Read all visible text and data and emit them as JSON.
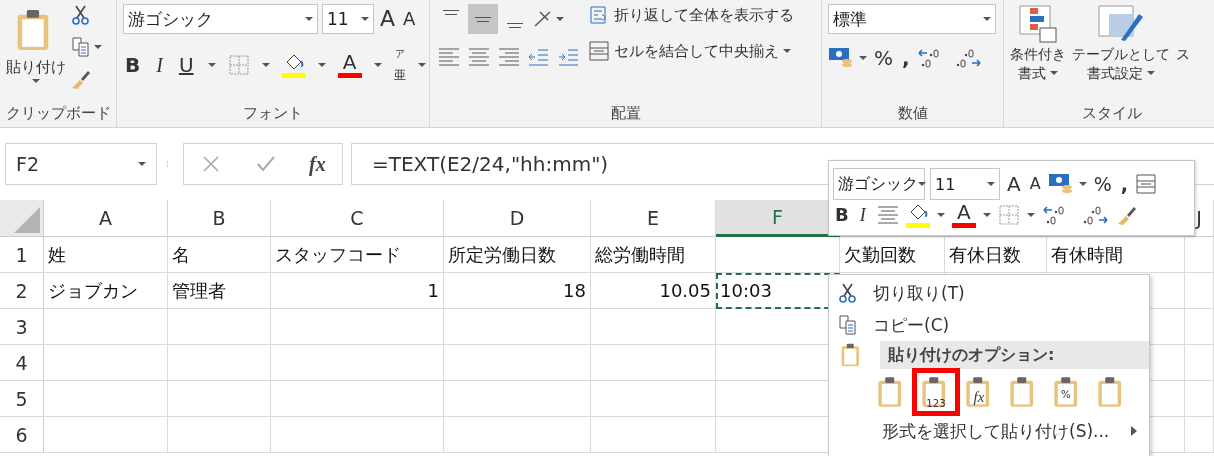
{
  "ribbon": {
    "clipboard": {
      "label": "クリップボード",
      "paste_label": "貼り付け"
    },
    "font": {
      "label": "フォント",
      "font_name": "游ゴシック",
      "font_size": "11",
      "grow": "A",
      "shrink": "A",
      "bold": "B",
      "italic": "I",
      "underline": "U",
      "font_color": "A",
      "phonetic_top": "ア",
      "phonetic_bottom": "亜"
    },
    "alignment": {
      "label": "配置",
      "vertical": [
        {
          "selected": false
        },
        {
          "selected": true
        },
        {
          "selected": false
        }
      ],
      "wrap_label": "折り返して全体を表示する",
      "merge_label": "セルを結合して中央揃え"
    },
    "number": {
      "label": "数値",
      "format": "標準",
      "percent": "%",
      "comma": ","
    },
    "styles": {
      "label": "スタイル",
      "buttons": [
        {
          "line1": "条件付き",
          "line2": "書式"
        },
        {
          "line1": "テーブルとして",
          "line2": "書式設定"
        },
        {
          "line1": "ス"
        }
      ]
    }
  },
  "formula_bar": {
    "name_box": "F2",
    "function_label": "fx",
    "formula": "=TEXT(E2/24,\"hh:mm\")"
  },
  "grid": {
    "columns": [
      {
        "label": "A",
        "selected": false
      },
      {
        "label": "B",
        "selected": false
      },
      {
        "label": "C",
        "selected": false
      },
      {
        "label": "D",
        "selected": false
      },
      {
        "label": "E",
        "selected": false
      },
      {
        "label": "F",
        "selected": true
      },
      {},
      {},
      {},
      {
        "label": "J",
        "selected": false
      }
    ],
    "rows": [
      {
        "number": "1",
        "cells": [
          {
            "text": "姓",
            "kind": "text",
            "selected": false
          },
          {
            "text": "名",
            "kind": "text",
            "selected": false
          },
          {
            "text": "スタッフコード",
            "kind": "text",
            "selected": false
          },
          {
            "text": "所定労働日数",
            "kind": "text",
            "selected": false
          },
          {
            "text": "総労働時間",
            "kind": "text",
            "selected": false
          },
          null,
          {
            "text": "欠勤回数",
            "kind": "text",
            "selected": false
          },
          {
            "text": "有休日数",
            "kind": "text",
            "selected": false
          },
          {
            "text": "有休時間",
            "kind": "text",
            "selected": false
          }
        ]
      },
      {
        "number": "2",
        "cells": [
          {
            "text": "ジョブカン",
            "kind": "text",
            "selected": false
          },
          {
            "text": "管理者",
            "kind": "text",
            "selected": false
          },
          {
            "text": "1",
            "kind": "number",
            "selected": false
          },
          {
            "text": "18",
            "kind": "number",
            "selected": false
          },
          {
            "text": "10.05",
            "kind": "number",
            "selected": false
          },
          {
            "text": "10:03",
            "kind": "text",
            "selected": true
          }
        ]
      },
      {
        "number": "3"
      },
      {
        "number": "4"
      },
      {
        "number": "5"
      },
      {
        "number": "6"
      }
    ]
  },
  "mini_toolbar": {
    "font_name": "游ゴシック",
    "font_size": "11",
    "grow": "A",
    "shrink": "A",
    "percent": "%",
    "comma": ",",
    "bold": "B",
    "italic": "I",
    "font_color": "A"
  },
  "context_menu": {
    "items": [
      {
        "kind": "cut",
        "label": "切り取り(T)"
      },
      {
        "kind": "copy",
        "label": "コピー(C)"
      },
      {
        "kind": "header",
        "label": "貼り付けのオプション:"
      },
      {
        "kind": "paste_options",
        "options": [
          {
            "selected": false
          },
          {
            "selected": true,
            "caption": "123"
          },
          {
            "selected": false,
            "caption": "fx"
          },
          {
            "selected": false
          },
          {
            "selected": false,
            "caption": "%"
          },
          {
            "selected": false
          }
        ]
      },
      {
        "kind": "submenu",
        "label": "形式を選択して貼り付け(S)..."
      }
    ]
  }
}
